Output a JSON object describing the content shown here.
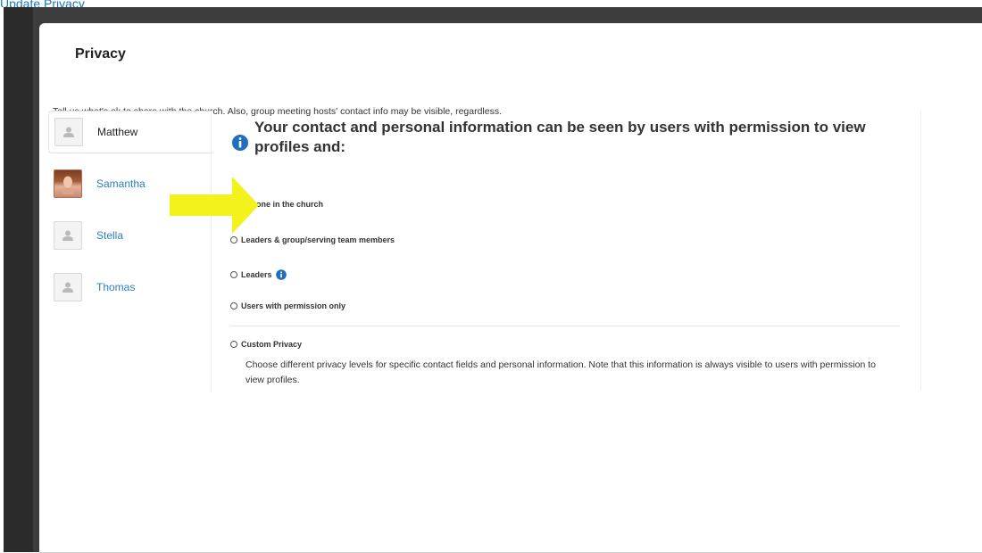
{
  "top_link": "Update Privacy",
  "panel": {
    "title": "Privacy",
    "description": "Tell us what's ok to share with the church. Also, group meeting hosts' contact info may be visible, regardless."
  },
  "people": [
    {
      "name": "Matthew",
      "avatar": "person-placeholder-icon",
      "active": true
    },
    {
      "name": "Samantha",
      "avatar": "photo",
      "active": false
    },
    {
      "name": "Stella",
      "avatar": "person-placeholder-icon",
      "active": false
    },
    {
      "name": "Thomas",
      "avatar": "person-placeholder-icon",
      "active": false
    }
  ],
  "headline": "Your contact and personal information can be seen by users with permission to view profiles and:",
  "options": [
    {
      "label": "Anyone in the church",
      "checked": true
    },
    {
      "label": "Leaders & group/serving team members",
      "checked": false
    },
    {
      "label": "Leaders",
      "checked": false,
      "info_icon": true
    },
    {
      "label": "Users with permission only",
      "checked": false
    },
    {
      "label": "Custom Privacy",
      "checked": false
    }
  ],
  "custom_description": "Choose different privacy levels for specific contact fields and personal information. Note that this information is always visible to users with permission to view profiles.",
  "colors": {
    "accent": "#2a6fbf",
    "link": "#2d7fc4",
    "arrow": "#f4f21c",
    "frame": "#3d3d3d"
  }
}
